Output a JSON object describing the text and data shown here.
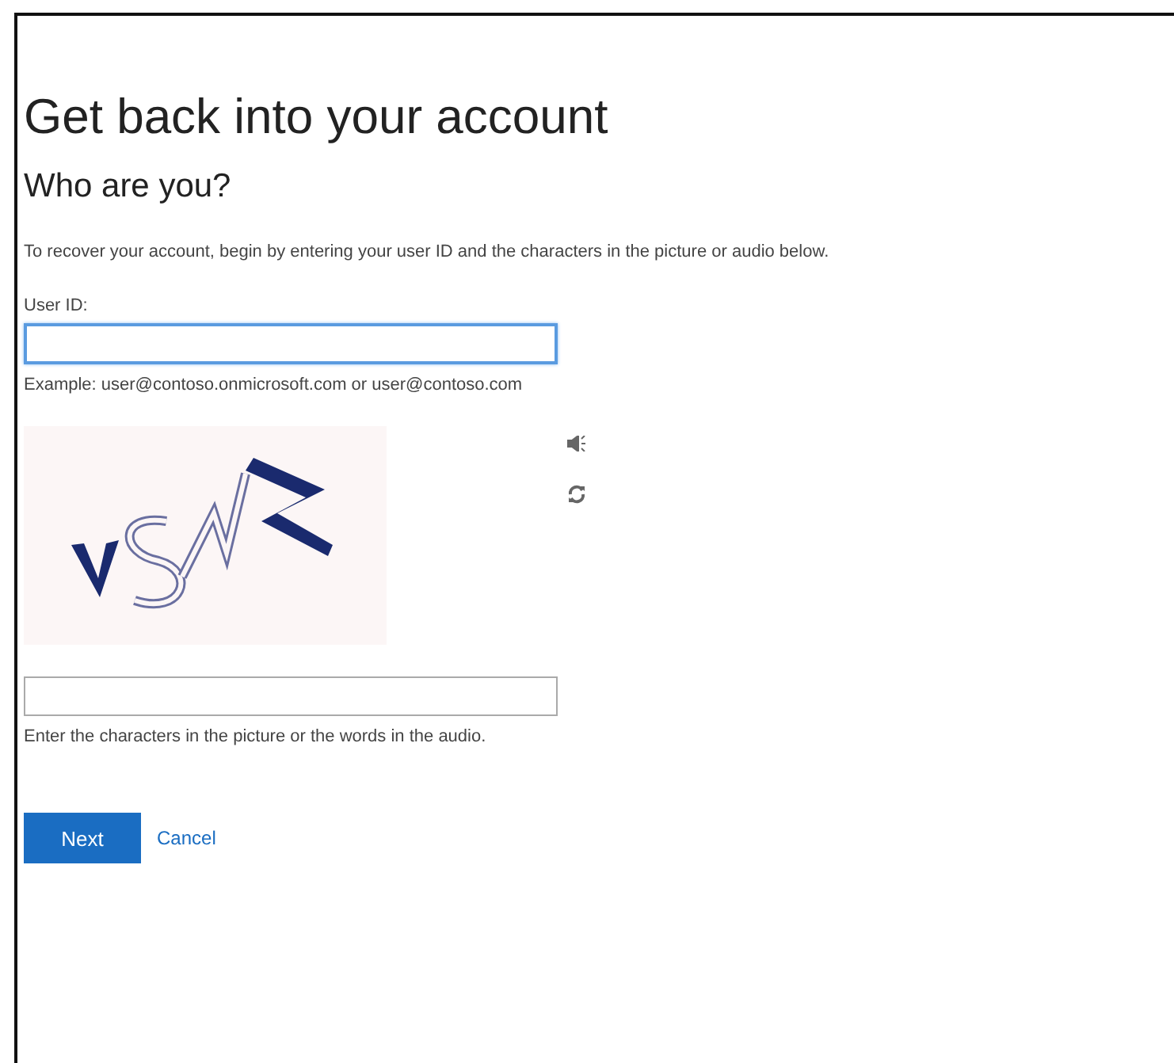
{
  "title": "Get back into your account",
  "subtitle": "Who are you?",
  "intro": "To recover your account, begin by entering your user ID and the characters in the picture or audio below.",
  "user_id": {
    "label": "User ID:",
    "hint": "Example: user@contoso.onmicrosoft.com or user@contoso.com",
    "focused": true
  },
  "captcha": {
    "kind": "picture",
    "hint": "Enter the characters in the picture or the words in the audio."
  },
  "buttons": [
    {
      "kind": "primary",
      "label": "Next"
    },
    {
      "kind": "link",
      "label": "Cancel"
    }
  ]
}
